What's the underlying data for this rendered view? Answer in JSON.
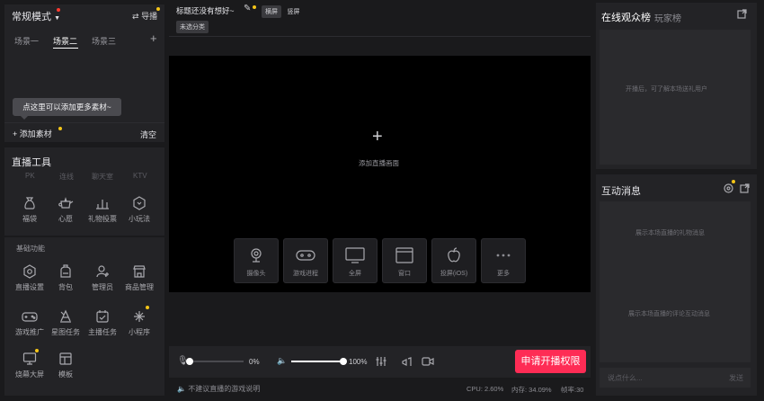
{
  "left": {
    "mode_label": "常规模式",
    "assistant_label": "导播",
    "scenes": [
      "场景一",
      "场景二",
      "场景三"
    ],
    "add_scene_symbol": "+",
    "tooltip": "点这里可以添加更多素材~",
    "add_material_label": "添加素材",
    "clear_label": "清空",
    "tools_title": "直播工具",
    "tools_faded": [
      "PK",
      "连线",
      "聊天室",
      "KTV"
    ],
    "tools_row": [
      "福袋",
      "心愿",
      "礼物投票",
      "小玩法"
    ],
    "basic_title": "基础功能",
    "basic": [
      "直播设置",
      "背包",
      "管理员",
      "商品管理",
      "游戏推广",
      "星图任务",
      "主播任务",
      "小程序",
      "烧幕大屏",
      "模板"
    ]
  },
  "top": {
    "title": "标题还没有想好~",
    "tag_landscape": "横屏",
    "tag_portrait": "竖屏",
    "tag_category": "未选分类"
  },
  "preview": {
    "plus": "+",
    "add_text": "添加直播画面",
    "sources": [
      "摄像头",
      "游戏进程",
      "全屏",
      "窗口",
      "投屏(iOS)",
      "更多"
    ]
  },
  "controls": {
    "mic_percent": "0%",
    "speaker_percent": "100%",
    "mic_level": 0,
    "speaker_level": 1,
    "apply_button": "申请开播权限"
  },
  "status": {
    "warning": "不建议直播的游戏说明",
    "cpu": "CPU: 2.60%",
    "mem": "内存: 34.09%",
    "fps": "帧率:30"
  },
  "right": {
    "tab_audience": "在线观众榜",
    "tab_players": "玩家榜",
    "audience_hint": "开播后，可了解本场送礼用户",
    "interaction_title": "互动消息",
    "gift_hint": "展示本场直播的礼物消息",
    "comment_hint": "展示本场直播的评论互动消息",
    "chat_placeholder": "说点什么...",
    "send_label": "发送"
  },
  "colors": {
    "accent_red": "#fe2c55",
    "badge_yellow": "#f5c518",
    "panel_bg": "#232326",
    "app_bg": "#1a1a1c"
  }
}
